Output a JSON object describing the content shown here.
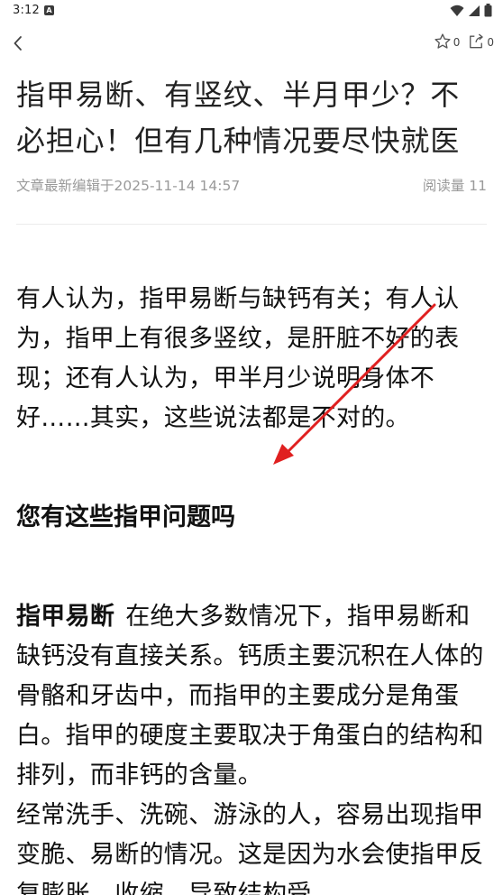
{
  "status_bar": {
    "time": "3:12",
    "app_icon": "A"
  },
  "toolbar": {
    "icons": {
      "back": "chevron-left-icon",
      "favorite": "star-outline-icon",
      "share": "share-icon"
    },
    "favorite_count": "0",
    "share_count": "0"
  },
  "article": {
    "title": "指甲易断、有竖纹、半月甲少？不必担心！但有几种情况要尽快就医",
    "edited_label": "文章最新编辑于2025-11-14 14:57",
    "read_count_label": "阅读量 11",
    "intro": "有人认为，指甲易断与缺钙有关；有人认为，指甲上有很多竖纹，是肝脏不好的表现；还有人认为，甲半月少说明身体不好……其实，这些说法都是不对的。",
    "section_heading": "您有这些指甲问题吗",
    "subsection_lead": "指甲易断",
    "subsection_text": "在绝大多数情况下，指甲易断和缺钙没有直接关系。钙质主要沉积在人体的骨骼和牙齿中，而指甲的主要成分是角蛋白。指甲的硬度主要取决于角蛋白的结构和排列，而非钙的含量。",
    "subsection_text_2": "经常洗手、洗碗、游泳的人，容易出现指甲变脆、易断的情况。这是因为水会使指甲反复膨胀、收缩，导致结构受"
  },
  "colors": {
    "annotation_arrow": "#e02020",
    "meta_text": "#9a9a9a"
  }
}
